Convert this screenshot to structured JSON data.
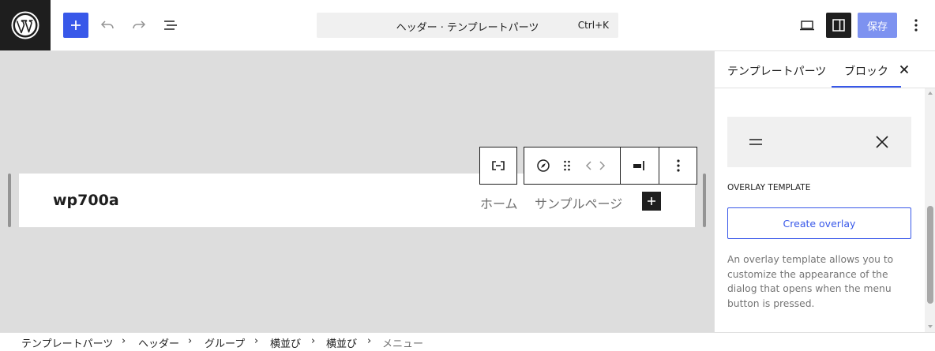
{
  "topbar": {
    "command_title": "ヘッダー · テンプレートパーツ",
    "command_shortcut": "Ctrl+K",
    "save_label": "保存"
  },
  "canvas": {
    "site_title": "wp700a",
    "nav_items": [
      "ホーム",
      "サンプルページ"
    ]
  },
  "breadcrumb": [
    "テンプレートパーツ",
    "ヘッダー",
    "グループ",
    "横並び",
    "横並び",
    "メニュー"
  ],
  "sidebar": {
    "tabs": [
      "テンプレートパーツ",
      "ブロック"
    ],
    "active_tab": "ブロック",
    "section_label": "OVERLAY TEMPLATE",
    "create_overlay_label": "Create overlay",
    "help_text": "An overlay template allows you to customize the appearance of the dialog that opens when the menu button is pressed."
  },
  "icons": {
    "logo": "wordpress-logo-icon",
    "add": "plus-icon",
    "undo": "undo-icon",
    "redo": "redo-icon",
    "list_view": "list-view-icon",
    "device_preview": "desktop-icon",
    "settings": "sidebar-toggle-icon",
    "options": "vertical-ellipsis-icon",
    "close": "close-icon"
  },
  "colors": {
    "accent": "#3858e9",
    "dark": "#1e1e1e",
    "canvas": "#dddddd"
  }
}
